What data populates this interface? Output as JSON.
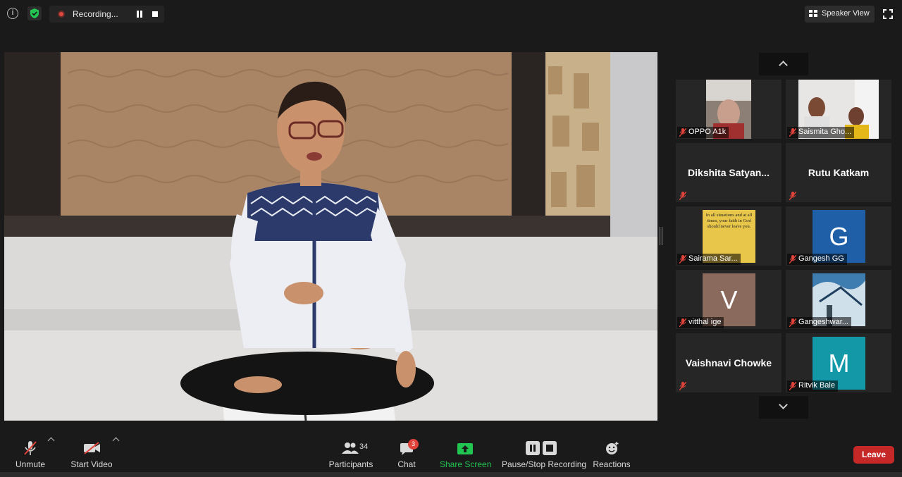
{
  "top_bar": {
    "recording_label": "Recording...",
    "speaker_view_label": "Speaker View"
  },
  "gallery": {
    "tiles": [
      {
        "name": "OPPO A1k",
        "type": "video"
      },
      {
        "name": "Saismita Gho...",
        "type": "video"
      },
      {
        "name": "Dikshita  Satyan...",
        "type": "name-only"
      },
      {
        "name": "Rutu Katkam",
        "type": "name-only"
      },
      {
        "name": "Sairama Sar...",
        "type": "image",
        "image_text": "In all situations and at all times, your faith in God should never leave you."
      },
      {
        "name": "Gangesh GG",
        "type": "letter",
        "letter": "G",
        "color": "#1e5fa8"
      },
      {
        "name": "vitthal ige",
        "type": "letter",
        "letter": "V",
        "color": "#8a6a5c"
      },
      {
        "name": "Gangeshwar...",
        "type": "image"
      },
      {
        "name": "Vaishnavi Chowke",
        "type": "name-only"
      },
      {
        "name": "Ritvik Bale",
        "type": "letter",
        "letter": "M",
        "color": "#1398a8"
      }
    ]
  },
  "toolbar": {
    "unmute_label": "Unmute",
    "start_video_label": "Start Video",
    "participants_label": "Participants",
    "participants_count": "34",
    "chat_label": "Chat",
    "chat_badge": "3",
    "share_screen_label": "Share Screen",
    "recording_label": "Pause/Stop Recording",
    "reactions_label": "Reactions",
    "leave_label": "Leave"
  },
  "colors": {
    "share_green": "#23c552",
    "leave_red": "#c62828",
    "mic_off_red": "#e0433a",
    "chat_badge": "#e0433a"
  }
}
